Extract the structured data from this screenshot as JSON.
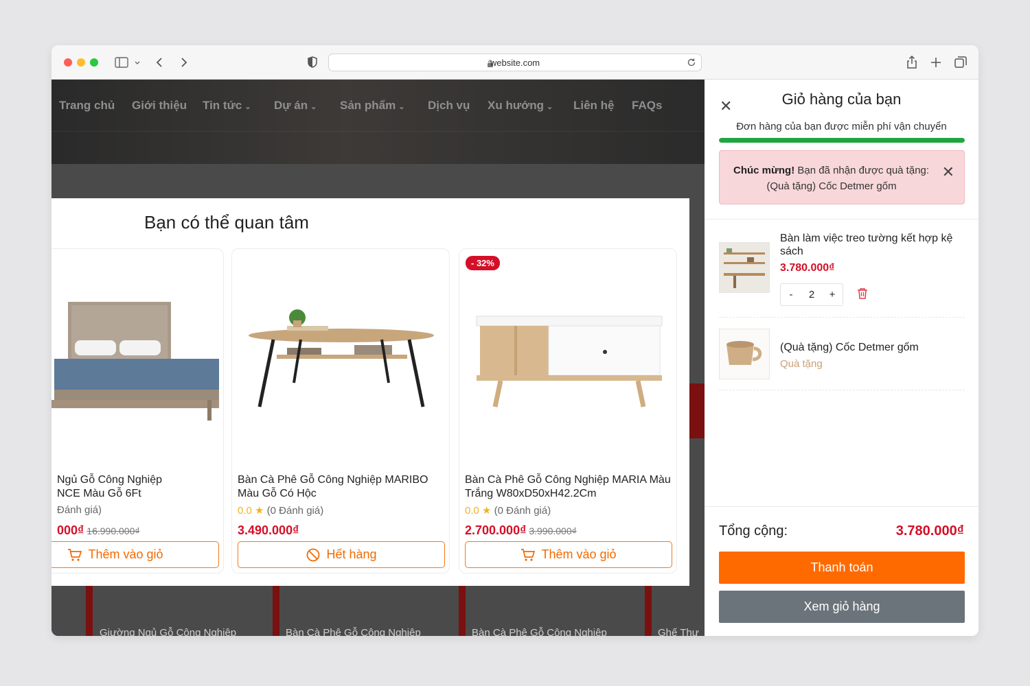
{
  "browser": {
    "url": "website.com"
  },
  "nav": {
    "items": [
      {
        "label": "Trang chủ"
      },
      {
        "label": "Giới thiệu"
      },
      {
        "label": "Tin tức"
      },
      {
        "label": "Dự án"
      },
      {
        "label": "Sản phẩm"
      },
      {
        "label": "Dịch vụ"
      },
      {
        "label": "Xu hướng"
      },
      {
        "label": "Liên hệ"
      },
      {
        "label": "FAQs"
      }
    ]
  },
  "popup": {
    "title": "Bạn có thể quan tâm",
    "products": [
      {
        "name": "Giường Ngủ Gỗ Công Nghiệp ... NCE Màu Gỗ 6Ft",
        "name_visible": "Ngủ Gỗ Công Nghiệp\nNCE Màu Gỗ 6Ft",
        "rating_text": "Đánh giá)",
        "price": "000₫",
        "old_price": "16.990.000₫",
        "button": "Thêm vào giỏ",
        "image_icon": "bed-image"
      },
      {
        "name": "Bàn Cà Phê Gỗ Công Nghiệp MARIBO Màu Gỗ Có Hộc",
        "rating_score": "0.0",
        "star": "★",
        "rating_text": "(0 Đánh giá)",
        "price": "3.490.000₫",
        "button": "Hết hàng",
        "image_icon": "coffee-table-image"
      },
      {
        "name": "Bàn Cà Phê Gỗ Công Nghiệp MARIA Màu Trắng W80xD50xH42.2Cm",
        "rating_score": "0.0",
        "star": "★",
        "rating_text": "(0 Đánh giá)",
        "price": "2.700.000₫",
        "old_price": "3.990.000₫",
        "button": "Thêm vào giỏ",
        "badge": "- 32%",
        "image_icon": "white-coffee-table-image"
      }
    ]
  },
  "background": {
    "captions": [
      "Giường Ngủ Gỗ Công Nghiệp",
      "Bàn Cà Phê Gỗ Công Nghiệp",
      "Bàn Cà Phê Gỗ Công Nghiệp",
      "Ghế Thư"
    ]
  },
  "cart": {
    "title": "Giỏ hàng của bạn",
    "shipping_text": "Đơn hàng của bạn được miễn phí vận chuyển",
    "shipping_progress": 1.0,
    "congrats_bold": "Chúc mừng!",
    "congrats_text": " Bạn đã nhận được quà tặng:",
    "congrats_gift": "(Quà tặng) Cốc Detmer gốm",
    "items": [
      {
        "name": "Bàn làm việc treo tường kết hợp kệ sách",
        "price": "3.780.000₫",
        "qty_minus": "-",
        "qty": "2",
        "qty_plus": "+",
        "image_icon": "wall-desk-image"
      },
      {
        "name": "(Quà tặng) Cốc Detmer gốm",
        "gift_label": "Quà tặng",
        "image_icon": "ceramic-cup-image"
      }
    ],
    "total_label": "Tổng cộng:",
    "total_value": "3.780.000₫",
    "pay_button": "Thanh toán",
    "view_button": "Xem giỏ hàng"
  },
  "colors": {
    "accent_orange": "#ff6a00",
    "price_red": "#d40f27",
    "progress_green": "#21a540",
    "alert_pink": "#f8d7da",
    "secondary_gray": "#6b737b"
  }
}
